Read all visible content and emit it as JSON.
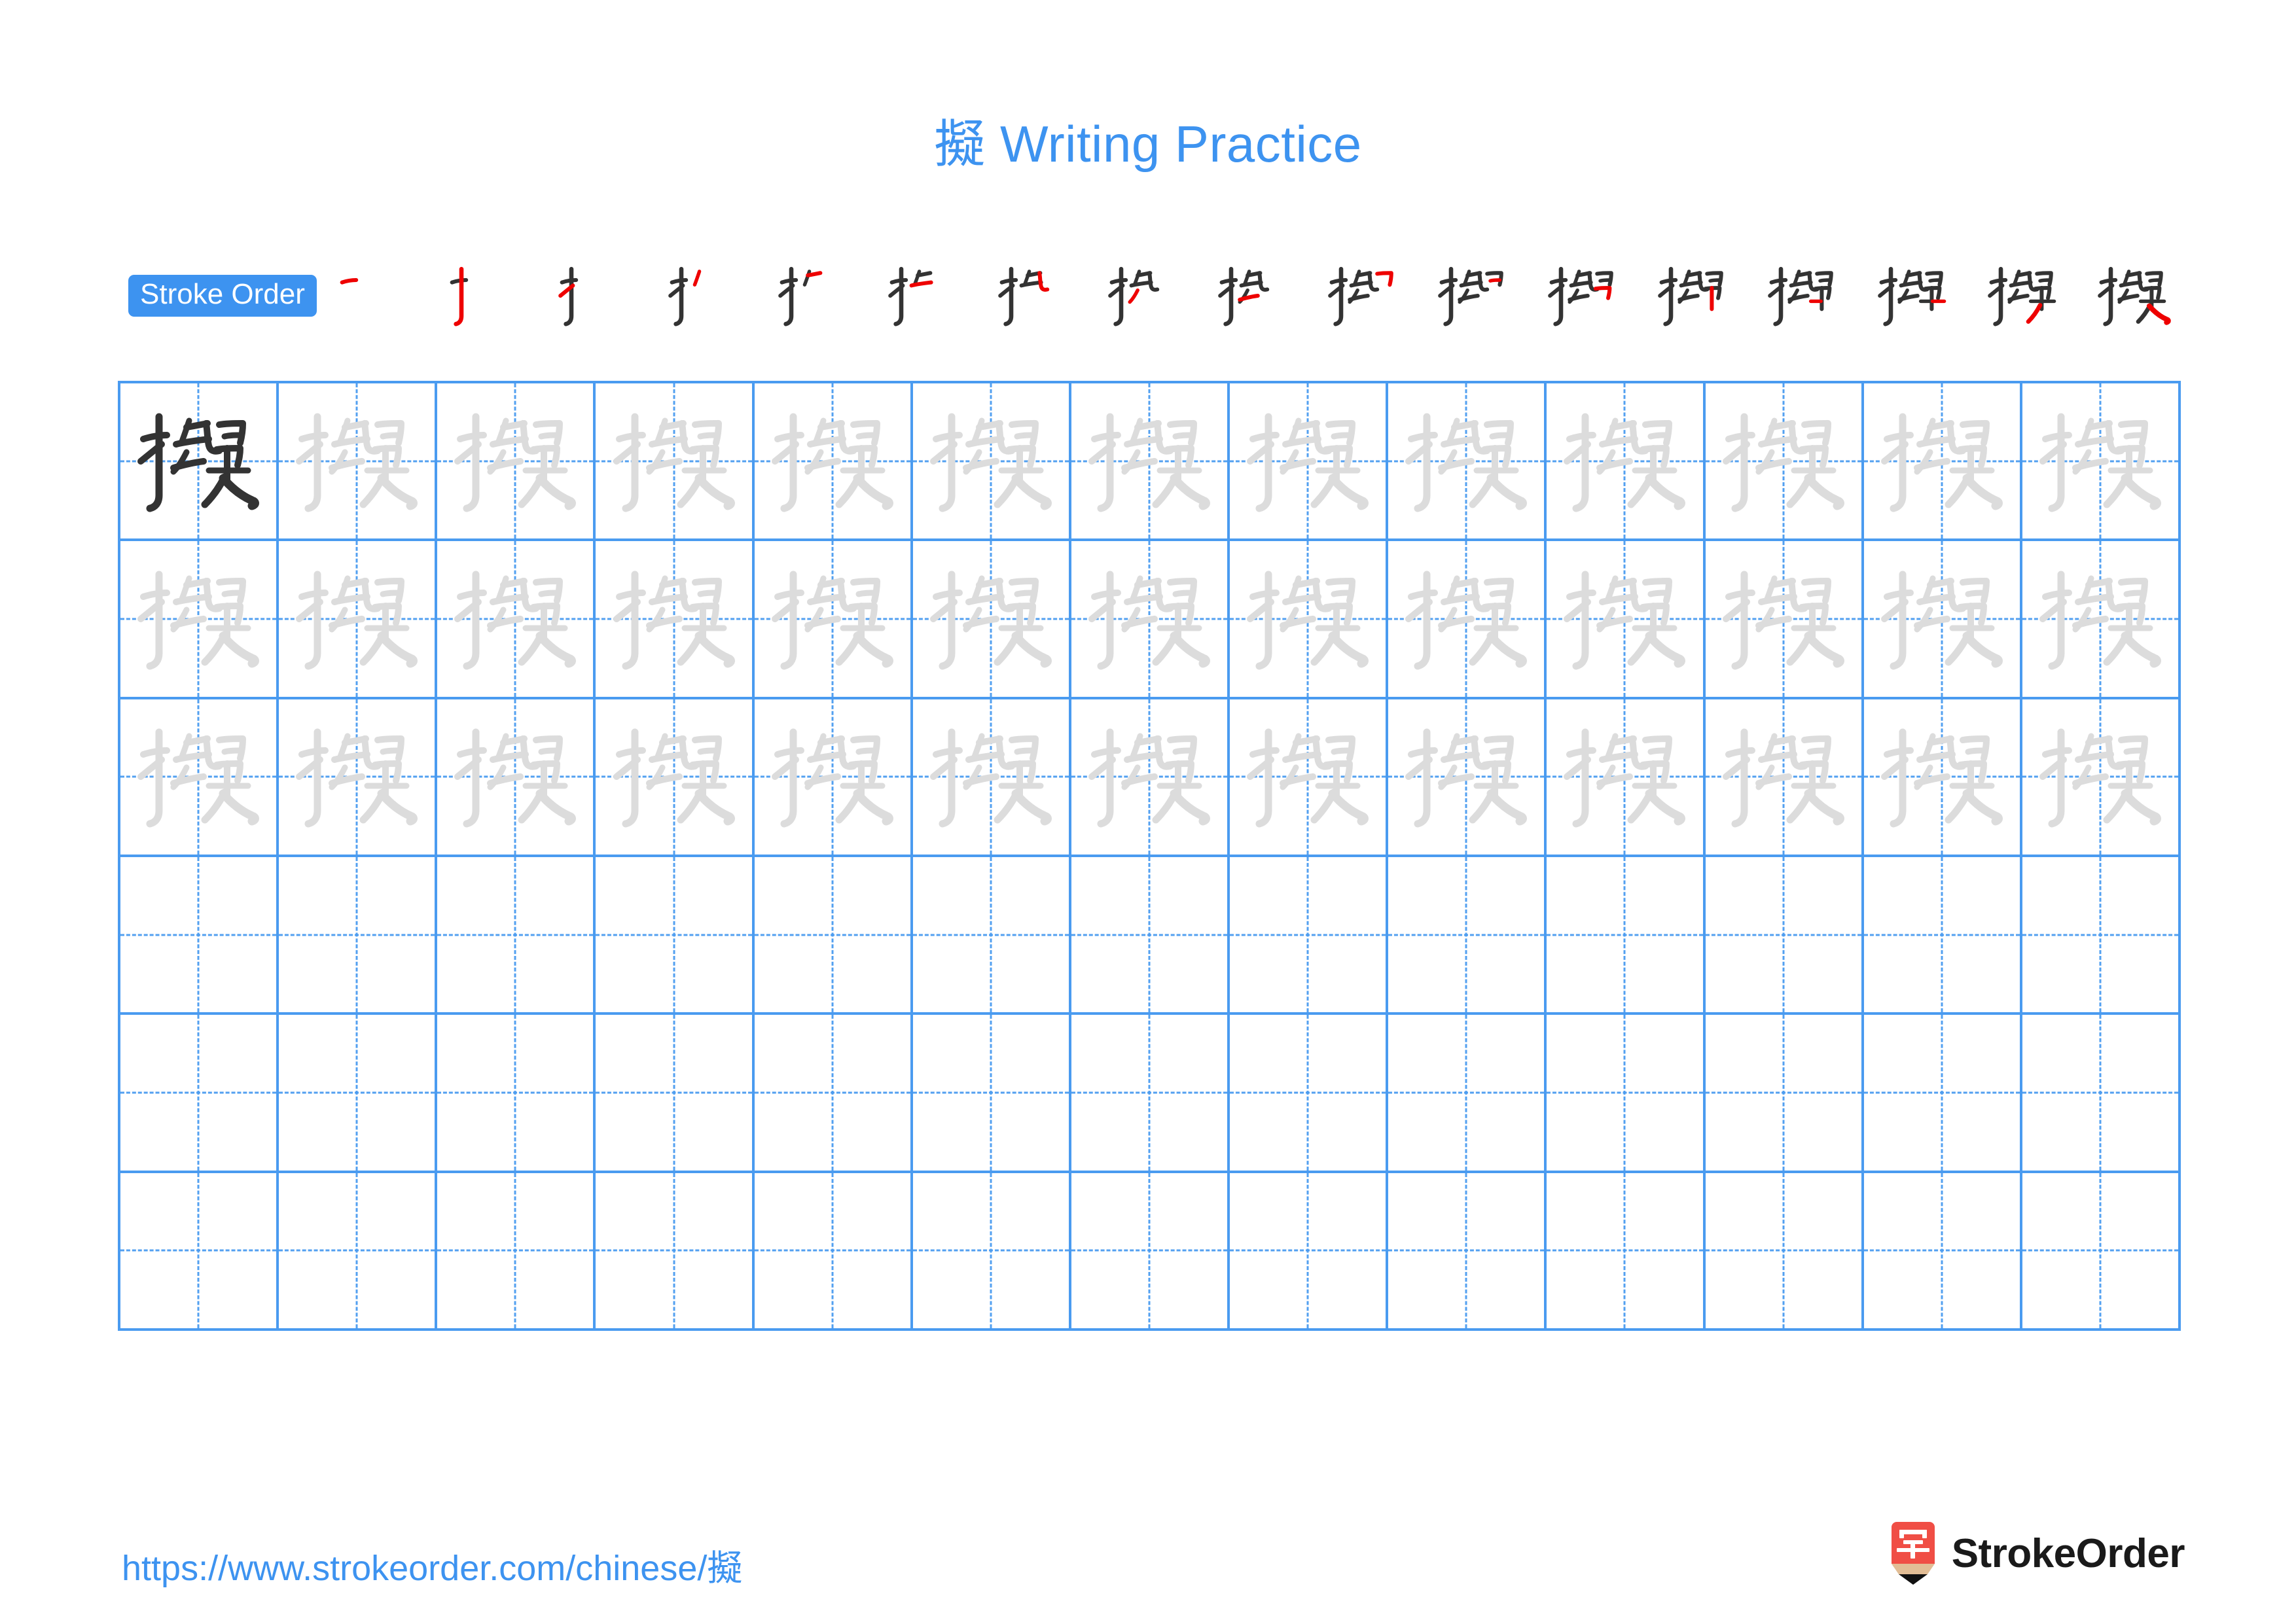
{
  "character": "擬",
  "title": {
    "character": "擬",
    "text": "Writing Practice",
    "full": "擬 Writing Practice",
    "color": "#3d93f0"
  },
  "stroke_order": {
    "badge_label": "Stroke Order",
    "badge_bg": "#3d93f0",
    "badge_text_color": "#ffffff",
    "total_strokes": 17,
    "new_stroke_color": "#ee0000",
    "existing_stroke_color": "#333333",
    "steps": [
      {
        "index": 1,
        "strokes_shown": 1,
        "label": "一"
      },
      {
        "index": 2,
        "strokes_shown": 2,
        "label": "亅"
      },
      {
        "index": 3,
        "strokes_shown": 3,
        "label": "扌"
      },
      {
        "index": 4,
        "strokes_shown": 4,
        "label": "扌丿"
      },
      {
        "index": 5,
        "strokes_shown": 5,
        "label": "扌匕"
      },
      {
        "index": 6,
        "strokes_shown": 6,
        "label": "扌匕"
      },
      {
        "index": 7,
        "strokes_shown": 7,
        "label": "扌匕"
      },
      {
        "index": 8,
        "strokes_shown": 8,
        "label": "扌匕"
      },
      {
        "index": 9,
        "strokes_shown": 9,
        "label": "扌㠯"
      },
      {
        "index": 10,
        "strokes_shown": 10,
        "label": "扌㠯"
      },
      {
        "index": 11,
        "strokes_shown": 11,
        "label": "扌矣"
      },
      {
        "index": 12,
        "strokes_shown": 12,
        "label": "扌矣"
      },
      {
        "index": 13,
        "strokes_shown": 13,
        "label": "扌矣"
      },
      {
        "index": 14,
        "strokes_shown": 14,
        "label": "擬"
      },
      {
        "index": 15,
        "strokes_shown": 15,
        "label": "擬"
      },
      {
        "index": 16,
        "strokes_shown": 16,
        "label": "擬"
      },
      {
        "index": 17,
        "strokes_shown": 17,
        "label": "擬"
      }
    ]
  },
  "grid": {
    "columns": 13,
    "rows": 6,
    "line_color": "#4a9bf0",
    "guide_style": "dashed-cross",
    "model_glyph_color": "#333333",
    "trace_glyph_color": "#dcdcdc",
    "rows_data": [
      {
        "row": 1,
        "cells": [
          {
            "glyph": "擬",
            "style": "dark"
          },
          {
            "glyph": "擬",
            "style": "trace"
          },
          {
            "glyph": "擬",
            "style": "trace"
          },
          {
            "glyph": "擬",
            "style": "trace"
          },
          {
            "glyph": "擬",
            "style": "trace"
          },
          {
            "glyph": "擬",
            "style": "trace"
          },
          {
            "glyph": "擬",
            "style": "trace"
          },
          {
            "glyph": "擬",
            "style": "trace"
          },
          {
            "glyph": "擬",
            "style": "trace"
          },
          {
            "glyph": "擬",
            "style": "trace"
          },
          {
            "glyph": "擬",
            "style": "trace"
          },
          {
            "glyph": "擬",
            "style": "trace"
          },
          {
            "glyph": "擬",
            "style": "trace"
          }
        ]
      },
      {
        "row": 2,
        "cells": [
          {
            "glyph": "擬",
            "style": "trace"
          },
          {
            "glyph": "擬",
            "style": "trace"
          },
          {
            "glyph": "擬",
            "style": "trace"
          },
          {
            "glyph": "擬",
            "style": "trace"
          },
          {
            "glyph": "擬",
            "style": "trace"
          },
          {
            "glyph": "擬",
            "style": "trace"
          },
          {
            "glyph": "擬",
            "style": "trace"
          },
          {
            "glyph": "擬",
            "style": "trace"
          },
          {
            "glyph": "擬",
            "style": "trace"
          },
          {
            "glyph": "擬",
            "style": "trace"
          },
          {
            "glyph": "擬",
            "style": "trace"
          },
          {
            "glyph": "擬",
            "style": "trace"
          },
          {
            "glyph": "擬",
            "style": "trace"
          }
        ]
      },
      {
        "row": 3,
        "cells": [
          {
            "glyph": "擬",
            "style": "trace"
          },
          {
            "glyph": "擬",
            "style": "trace"
          },
          {
            "glyph": "擬",
            "style": "trace"
          },
          {
            "glyph": "擬",
            "style": "trace"
          },
          {
            "glyph": "擬",
            "style": "trace"
          },
          {
            "glyph": "擬",
            "style": "trace"
          },
          {
            "glyph": "擬",
            "style": "trace"
          },
          {
            "glyph": "擬",
            "style": "trace"
          },
          {
            "glyph": "擬",
            "style": "trace"
          },
          {
            "glyph": "擬",
            "style": "trace"
          },
          {
            "glyph": "擬",
            "style": "trace"
          },
          {
            "glyph": "擬",
            "style": "trace"
          },
          {
            "glyph": "擬",
            "style": "trace"
          }
        ]
      },
      {
        "row": 4,
        "cells": [
          {
            "glyph": "",
            "style": "empty"
          },
          {
            "glyph": "",
            "style": "empty"
          },
          {
            "glyph": "",
            "style": "empty"
          },
          {
            "glyph": "",
            "style": "empty"
          },
          {
            "glyph": "",
            "style": "empty"
          },
          {
            "glyph": "",
            "style": "empty"
          },
          {
            "glyph": "",
            "style": "empty"
          },
          {
            "glyph": "",
            "style": "empty"
          },
          {
            "glyph": "",
            "style": "empty"
          },
          {
            "glyph": "",
            "style": "empty"
          },
          {
            "glyph": "",
            "style": "empty"
          },
          {
            "glyph": "",
            "style": "empty"
          },
          {
            "glyph": "",
            "style": "empty"
          }
        ]
      },
      {
        "row": 5,
        "cells": [
          {
            "glyph": "",
            "style": "empty"
          },
          {
            "glyph": "",
            "style": "empty"
          },
          {
            "glyph": "",
            "style": "empty"
          },
          {
            "glyph": "",
            "style": "empty"
          },
          {
            "glyph": "",
            "style": "empty"
          },
          {
            "glyph": "",
            "style": "empty"
          },
          {
            "glyph": "",
            "style": "empty"
          },
          {
            "glyph": "",
            "style": "empty"
          },
          {
            "glyph": "",
            "style": "empty"
          },
          {
            "glyph": "",
            "style": "empty"
          },
          {
            "glyph": "",
            "style": "empty"
          },
          {
            "glyph": "",
            "style": "empty"
          },
          {
            "glyph": "",
            "style": "empty"
          }
        ]
      },
      {
        "row": 6,
        "cells": [
          {
            "glyph": "",
            "style": "empty"
          },
          {
            "glyph": "",
            "style": "empty"
          },
          {
            "glyph": "",
            "style": "empty"
          },
          {
            "glyph": "",
            "style": "empty"
          },
          {
            "glyph": "",
            "style": "empty"
          },
          {
            "glyph": "",
            "style": "empty"
          },
          {
            "glyph": "",
            "style": "empty"
          },
          {
            "glyph": "",
            "style": "empty"
          },
          {
            "glyph": "",
            "style": "empty"
          },
          {
            "glyph": "",
            "style": "empty"
          },
          {
            "glyph": "",
            "style": "empty"
          },
          {
            "glyph": "",
            "style": "empty"
          },
          {
            "glyph": "",
            "style": "empty"
          }
        ]
      }
    ]
  },
  "footer": {
    "url": "https://www.strokeorder.com/chinese/擬",
    "url_color": "#3d93f0",
    "logo_text": "StrokeOrder",
    "logo_glyph": "字",
    "logo_bg": "#f04e45",
    "logo_pencil_body": "#e2bd95",
    "logo_tip": "#111111"
  }
}
